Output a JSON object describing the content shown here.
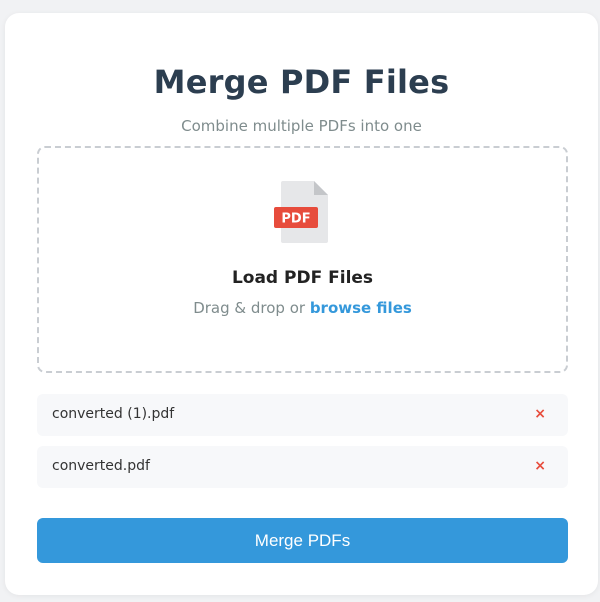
{
  "header": {
    "title": "Merge PDF Files",
    "subtitle": "Combine multiple PDFs into one"
  },
  "dropzone": {
    "icon": "pdf-file-icon",
    "icon_badge": "PDF",
    "title": "Load PDF Files",
    "hint_prefix": "Drag & drop or ",
    "browse_label": "browse files"
  },
  "files": [
    {
      "name": "converted (1).pdf",
      "remove_label": "×"
    },
    {
      "name": "converted.pdf",
      "remove_label": "×"
    }
  ],
  "actions": {
    "merge_label": "Merge PDFs"
  },
  "colors": {
    "accent": "#3498db",
    "title": "#2c3e50",
    "remove": "#e74c3c",
    "pdf_badge": "#e74c3c"
  }
}
